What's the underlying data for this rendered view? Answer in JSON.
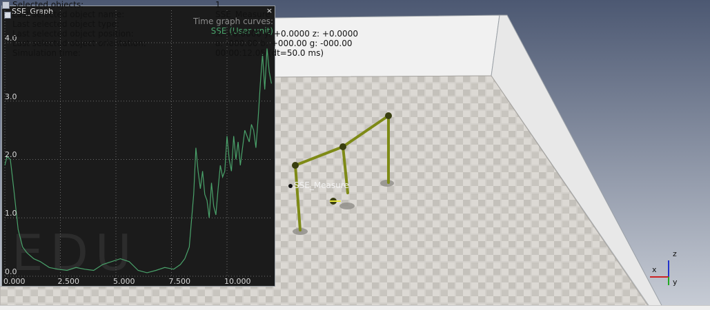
{
  "info_overlay": {
    "rows": [
      {
        "label": "Selected objects:",
        "value": "1"
      },
      {
        "label": "Last selected object name:",
        "value": "SSE_Measure"
      },
      {
        "label": "Last selected object type:",
        "value": ""
      },
      {
        "label": "Last selected object position:",
        "value": "x: +0.0000 y: +0.0000 z: +0.0000"
      },
      {
        "label": "Last selected object orientation:",
        "value": "a: -000.00 b: +000.00 g: -000.00"
      },
      {
        "label": "Simulation time:",
        "value": "00:00:12.05 (dt=50.0 ms)"
      }
    ]
  },
  "graph": {
    "title": "SSE_Graph",
    "close_glyph": "×",
    "curves_label": "Time graph curves:",
    "curve_name": "SSE (User unit)",
    "curve_color": "#4aa36b",
    "watermark": "EDU",
    "x_ticks": [
      "0.000",
      "2.500",
      "5.000",
      "7.500",
      "10.000"
    ],
    "y_ticks": [
      "4.0",
      "3.0",
      "2.0",
      "1.0",
      "0.0"
    ],
    "chart_data": {
      "type": "line",
      "xlim": [
        0,
        12.05
      ],
      "ylim": [
        0,
        4.2
      ],
      "grid": true,
      "series": [
        {
          "name": "SSE (User unit)",
          "x": [
            0,
            0.1,
            0.25,
            0.4,
            0.6,
            0.8,
            1.0,
            1.3,
            1.6,
            2.0,
            2.4,
            2.8,
            3.2,
            3.6,
            4.0,
            4.4,
            4.8,
            5.2,
            5.6,
            6.0,
            6.4,
            6.8,
            7.2,
            7.6,
            7.9,
            8.1,
            8.3,
            8.5,
            8.6,
            8.7,
            8.8,
            8.9,
            9.0,
            9.1,
            9.2,
            9.3,
            9.4,
            9.5,
            9.6,
            9.7,
            9.8,
            9.9,
            10.0,
            10.1,
            10.2,
            10.3,
            10.4,
            10.5,
            10.6,
            10.7,
            10.8,
            10.9,
            11.0,
            11.1,
            11.2,
            11.3,
            11.4,
            11.5,
            11.6,
            11.7,
            11.8,
            11.9,
            12.0
          ],
          "y": [
            1.9,
            2.05,
            2.0,
            1.5,
            0.8,
            0.5,
            0.4,
            0.3,
            0.25,
            0.15,
            0.12,
            0.1,
            0.15,
            0.12,
            0.1,
            0.2,
            0.25,
            0.3,
            0.25,
            0.1,
            0.06,
            0.1,
            0.15,
            0.12,
            0.2,
            0.3,
            0.5,
            1.4,
            2.2,
            1.8,
            1.5,
            1.8,
            1.4,
            1.3,
            1.0,
            1.6,
            1.2,
            1.05,
            1.5,
            1.9,
            1.7,
            1.8,
            2.4,
            2.0,
            1.8,
            2.4,
            2.0,
            2.3,
            1.9,
            2.2,
            2.5,
            2.4,
            2.3,
            2.6,
            2.5,
            2.2,
            2.7,
            3.3,
            3.8,
            3.2,
            3.9,
            3.5,
            3.3
          ]
        }
      ]
    }
  },
  "scene": {
    "object_label": "SSE_Measure",
    "floor_color": "#d3d0cb",
    "wall_color": "#f1f1f1",
    "sky_top": "#4c5872",
    "sky_bottom": "#c8cdd6",
    "rod_color": "#7e8a16",
    "axes": {
      "x": "x",
      "y": "y",
      "z": "z"
    }
  }
}
